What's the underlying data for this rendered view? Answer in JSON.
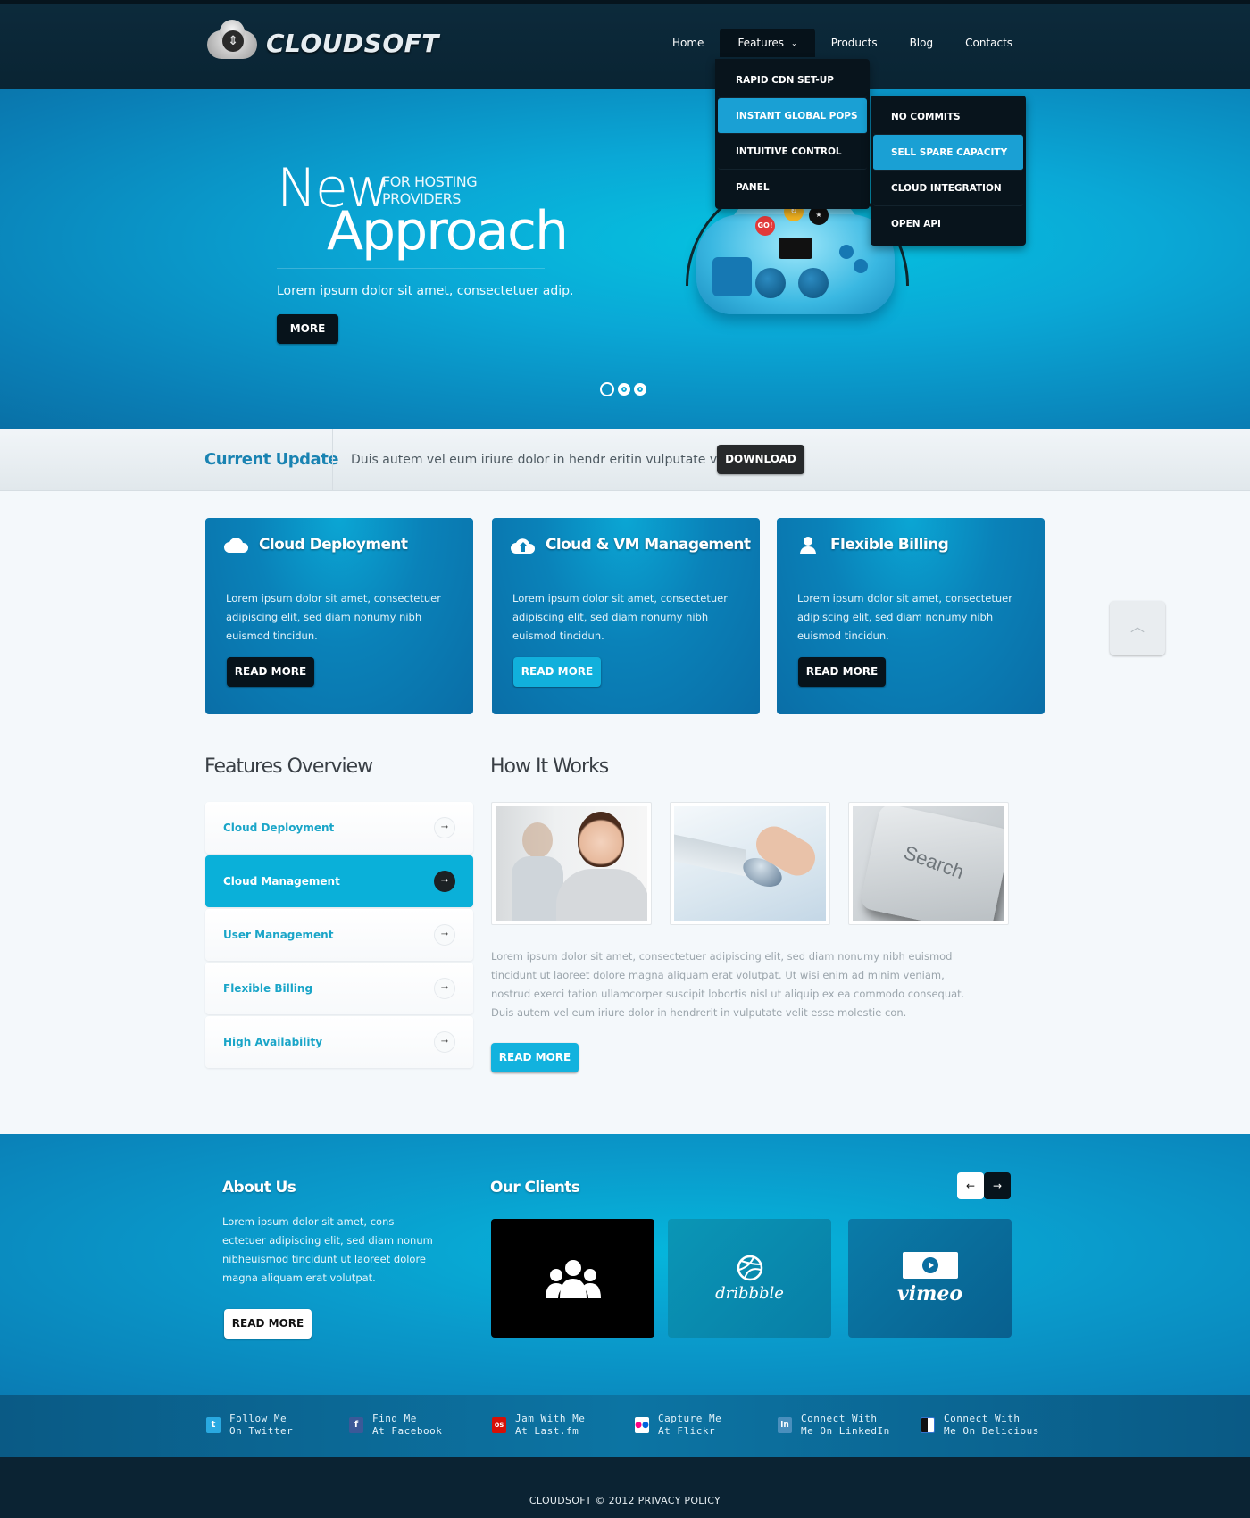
{
  "header": {
    "logo_text": "CLOUDSOFT",
    "nav": [
      {
        "label": "Home"
      },
      {
        "label": "Features",
        "active": true
      },
      {
        "label": "Products"
      },
      {
        "label": "Blog"
      },
      {
        "label": "Contacts"
      }
    ],
    "features_dropdown": [
      {
        "label": "RAPID CDN SET-UP"
      },
      {
        "label": "INSTANT GLOBAL POPS",
        "active": true
      },
      {
        "label": "INTUITIVE CONTROL"
      },
      {
        "label": "PANEL"
      }
    ],
    "sub_dropdown": [
      {
        "label": "NO COMMITS"
      },
      {
        "label": "SELL SPARE CAPACITY",
        "active": true
      },
      {
        "label": "CLOUD INTEGRATION"
      },
      {
        "label": "OPEN API"
      }
    ]
  },
  "hero": {
    "title_1": "New",
    "subtitle_1": "FOR HOSTING",
    "subtitle_2": "PROVIDERS",
    "title_2": "Approach",
    "description": "Lorem ipsum dolor sit amet, consectetuer adip.",
    "more_label": "MORE",
    "slide_count": 3,
    "active_slide": 1
  },
  "update": {
    "title": "Current Update",
    "text": "Duis autem vel eum iriure dolor in hendr eritin vulputate velit.",
    "download_label": "DOWNLOAD"
  },
  "cards": [
    {
      "icon": "cloud-icon",
      "title": "Cloud Deployment",
      "text": "Lorem ipsum dolor sit amet, consectetuer adipiscing elit, sed diam nonumy nibh euismod tincidun.",
      "button": "READ MORE"
    },
    {
      "icon": "cloud-upload-icon",
      "title": "Cloud & VM Management",
      "text": "Lorem ipsum dolor sit amet, consectetuer adipiscing elit, sed diam nonumy nibh euismod tincidun.",
      "button": "READ MORE"
    },
    {
      "icon": "user-icon",
      "title": "Flexible Billing",
      "text": "Lorem ipsum dolor sit amet, consectetuer adipiscing elit, sed diam nonumy nibh euismod tincidun.",
      "button": "READ MORE"
    }
  ],
  "features_overview": {
    "title": "Features Overview",
    "items": [
      {
        "label": "Cloud Deployment"
      },
      {
        "label": "Cloud Management",
        "active": true
      },
      {
        "label": "User Management"
      },
      {
        "label": "Flexible Billing"
      },
      {
        "label": "High Availability"
      }
    ]
  },
  "how_it_works": {
    "title": "How It Works",
    "images": [
      "businesswoman-photo",
      "computer-mouse-photo",
      "search-key-photo"
    ],
    "search_key_text": "Search",
    "text": "Lorem ipsum dolor sit amet, consectetuer adipiscing elit, sed diam nonumy nibh euismod tincidunt ut laoreet dolore magna aliquam erat volutpat. Ut wisi enim ad minim veniam, nostrud exerci tation ullamcorper suscipit lobortis nisl ut aliquip ex ea commodo consequat. Duis autem vel eum iriure dolor in hendrerit in vulputate velit esse molestie con.",
    "button": "READ MORE"
  },
  "about": {
    "title": "About Us",
    "text": "Lorem ipsum dolor sit amet, cons ectetuer adipiscing elit, sed diam nonum nibheuismod tincidunt ut laoreet dolore magna aliquam erat volutpat.",
    "button": "READ MORE"
  },
  "clients": {
    "title": "Our Clients",
    "prev": "←",
    "next": "→",
    "items": [
      {
        "name": "community-logo"
      },
      {
        "name": "dribbble",
        "label": "dribbble"
      },
      {
        "name": "vimeo",
        "label": "vimeo"
      }
    ]
  },
  "social": [
    {
      "line1": "Follow Me",
      "line2": "On Twitter",
      "icon": "t",
      "color": "#29a9e1"
    },
    {
      "line1": "Find Me",
      "line2": "At Facebook",
      "icon": "f",
      "color": "#3b5998"
    },
    {
      "line1": "Jam With Me",
      "line2": "At Last.fm",
      "icon": "os",
      "color": "#d51007"
    },
    {
      "line1": "Capture Me",
      "line2": "At Flickr",
      "icon": "••",
      "color": "#ffffff"
    },
    {
      "line1": "Connect With",
      "line2": "Me On LinkedIn",
      "icon": "in",
      "color": "#0e76a8"
    },
    {
      "line1": "Connect With",
      "line2": "Me On Delicious",
      "icon": "■",
      "color": "#3274d1"
    }
  ],
  "footer": {
    "brand": "CLOUDSOFT",
    "copyright": "© 2012",
    "privacy": "PRIVACY POLICY"
  },
  "colors": {
    "accent": "#0ab0d9",
    "dark": "#07131b",
    "header": "#0a2433"
  }
}
